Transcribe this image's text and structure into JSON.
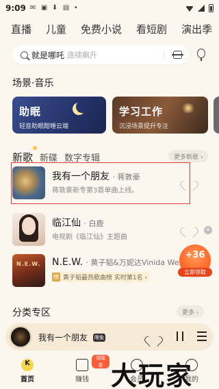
{
  "status": {
    "time": "9:09"
  },
  "top_tabs": [
    "直播",
    "儿童",
    "免费小说",
    "看短剧",
    "演出季"
  ],
  "search": {
    "query": "就是哪吒",
    "hint": "连续飙升"
  },
  "scene_section": {
    "title": "场景·音乐",
    "cards": [
      {
        "title": "助眠",
        "subtitle": "轻音助眠酣睡云端"
      },
      {
        "title": "学习工作",
        "subtitle": "沉浸场景提升专注"
      }
    ]
  },
  "music_tabs": {
    "items": [
      "新歌",
      "新碟",
      "数字专辑"
    ],
    "more": "更多新歌 ›"
  },
  "songs": [
    {
      "title": "我有一个朋友",
      "artist": "· 蒋敦豪",
      "sub": "蒋敦豪新专第3首单曲上线。"
    },
    {
      "title": "临江仙",
      "artist": "· 白鹿",
      "sub": "电视剧《临江仙》主题曲"
    },
    {
      "title": "N.E.W.",
      "artist": "· 黄子韬&万妮达Vinida We...",
      "badge_tag": "榜",
      "badge_text": "黄子韬最热歌曲榜 实时第1名 ›",
      "cover_text": "N.E.W."
    }
  ],
  "reward": {
    "value": "+36",
    "label": "立即领取"
  },
  "category": {
    "title": "分类专区",
    "more": "更多 ›"
  },
  "player": {
    "title": "我有一个朋友",
    "tag": "限免"
  },
  "bottom_nav": [
    {
      "label": "首页"
    },
    {
      "label": "赚钱",
      "badge": "领现金"
    },
    {
      "label": "会员"
    },
    {
      "label": "我的"
    }
  ],
  "watermark": "大玩家",
  "colors": {
    "highlight": "#e23a3a",
    "accent": "#f7d548",
    "reward": "#ff6a2a"
  }
}
